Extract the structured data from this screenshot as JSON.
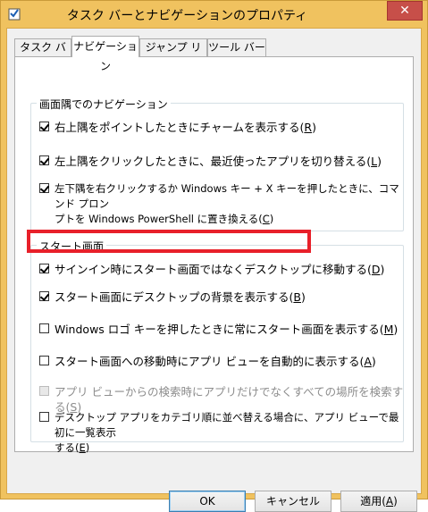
{
  "window": {
    "title": "タスク バーとナビゲーションのプロパティ",
    "close_glyph": "✕"
  },
  "tabs": [
    {
      "label": "タスク バー"
    },
    {
      "label": "ナビゲーション"
    },
    {
      "label": "ジャンプ リスト"
    },
    {
      "label": "ツール バー"
    }
  ],
  "corner_group": {
    "title": "画面隅でのナビゲーション",
    "items": [
      {
        "label": "右上隅をポイントしたときにチャームを表示する(",
        "key": "R",
        "suffix": ")",
        "checked": true
      },
      {
        "label": "左上隅をクリックしたときに、最近使ったアプリを切り替える(",
        "key": "L",
        "suffix": ")",
        "checked": true
      },
      {
        "line1": "左下隅を右クリックするか Windows キー + X キーを押したときに、コマンド プロン",
        "line2": "プトを Windows PowerShell に置き換える(",
        "key": "C",
        "suffix": ")",
        "checked": true
      }
    ]
  },
  "start_group": {
    "title": "スタート画面",
    "items": [
      {
        "label": "サインイン時にスタート画面ではなくデスクトップに移動する(",
        "key": "D",
        "suffix": ")",
        "checked": true
      },
      {
        "label": "スタート画面にデスクトップの背景を表示する(",
        "key": "B",
        "suffix": ")",
        "checked": true
      },
      {
        "label": "Windows ロゴ キーを押したときに常にスタート画面を表示する(",
        "key": "M",
        "suffix": ")",
        "checked": false
      },
      {
        "label": "スタート画面への移動時にアプリ ビューを自動的に表示する(",
        "key": "A",
        "suffix": ")",
        "checked": false
      },
      {
        "label": "アプリ ビューからの検索時にアプリだけでなくすべての場所を検索する(",
        "key": "S",
        "suffix": ")",
        "checked": false,
        "disabled": true
      },
      {
        "line1": "デスクトップ アプリをカテゴリ順に並べ替える場合に、アプリ ビューで最初に一覧表示",
        "line2": "する(",
        "key": "E",
        "suffix": ")",
        "checked": false
      }
    ]
  },
  "buttons": {
    "ok": "OK",
    "cancel": "キャンセル",
    "apply_prefix": "適用(",
    "apply_key": "A",
    "apply_suffix": ")"
  },
  "colors": {
    "frame": "#f0c25f",
    "close": "#c74f49",
    "highlight": "#e8202a"
  }
}
